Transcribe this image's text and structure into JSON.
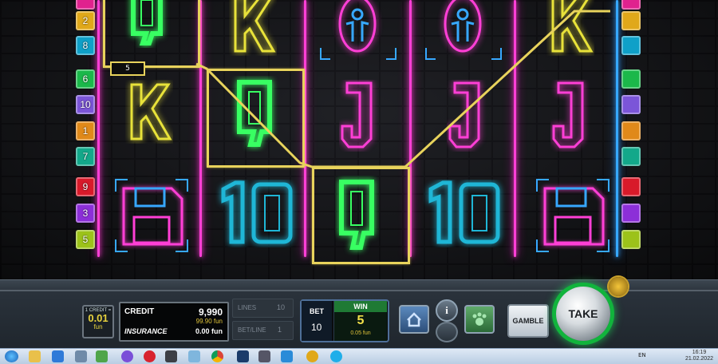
{
  "game": {
    "paylines_left": [
      "2",
      "8",
      "6",
      "10",
      "1",
      "7",
      "9",
      "3",
      "5"
    ],
    "paylines_right": [
      "",
      "",
      "",
      "",
      "",
      "",
      "",
      "",
      ""
    ],
    "win_line_label": "5",
    "reel_symbols": [
      [
        "Q",
        "K",
        "save-disk"
      ],
      [
        "K",
        "Q",
        "10"
      ],
      [
        "person-badge",
        "J",
        "Q"
      ],
      [
        "person-badge",
        "J",
        "10"
      ],
      [
        "K",
        "J",
        "save-disk"
      ]
    ]
  },
  "coin": {
    "label": "1 CREDIT =",
    "value": "0.01",
    "unit": "fun"
  },
  "credit": {
    "label": "CREDIT",
    "value": "9,990",
    "sub_value": "99.90 fun",
    "insurance_label": "INSURANCE",
    "insurance_value": "0.00 fun"
  },
  "lines": {
    "label": "LINES",
    "value": "10",
    "betline_label": "BET/LINE",
    "betline_value": "1"
  },
  "bet": {
    "label": "BET",
    "value": "10"
  },
  "win": {
    "label": "WIN",
    "value": "5",
    "sub_value": "0.05 fun"
  },
  "buttons": {
    "gamble": "GAMBLE",
    "take": "TAKE",
    "info": "i"
  },
  "taskbar": {
    "lang": "EN",
    "time": "16:19",
    "date": "21.02.2022"
  },
  "colors": {
    "neon_pink": "#ff3fd6",
    "neon_blue": "#37a8ff",
    "neon_green": "#38ff62",
    "neon_yellow": "#e8e23a",
    "win_frame": "#e8d35c",
    "take_ring": "#11b43c"
  }
}
